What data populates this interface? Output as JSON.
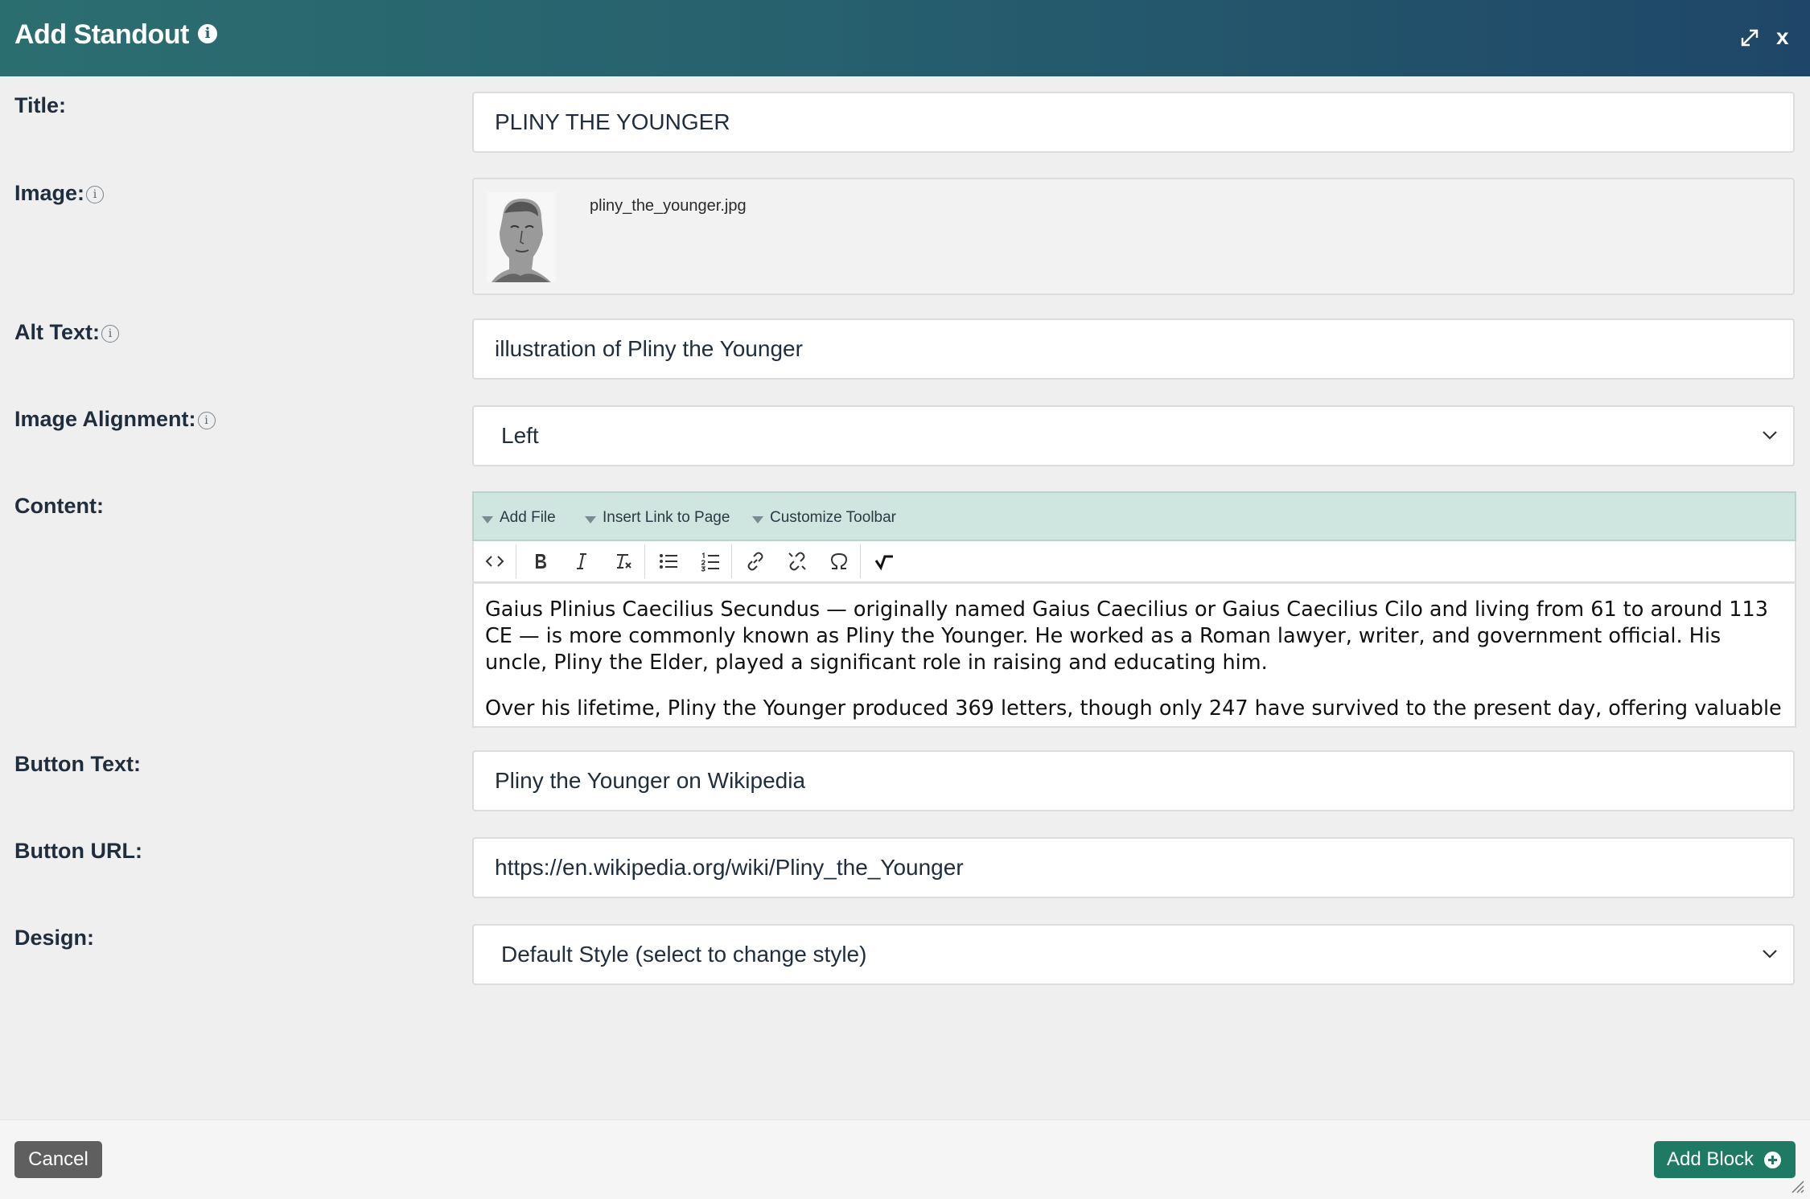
{
  "dialog": {
    "title": "Add Standout",
    "info_icon_glyph": "i",
    "close_label": "x"
  },
  "form": {
    "title": {
      "label": "Title:",
      "value": "PLINY THE YOUNGER"
    },
    "image": {
      "label": "Image:",
      "filename": "pliny_the_younger.jpg"
    },
    "alt_text": {
      "label": "Alt Text:",
      "value": "illustration of Pliny the Younger"
    },
    "image_alignment": {
      "label": "Image Alignment:",
      "value": "Left"
    },
    "content": {
      "label": "Content:",
      "menus": [
        "Add File",
        "Insert Link to Page",
        "Customize Toolbar"
      ],
      "toolbar_icons": [
        "source-code-icon",
        "bold-icon",
        "italic-icon",
        "remove-format-icon",
        "bulleted-list-icon",
        "numbered-list-icon",
        "link-icon",
        "unlink-icon",
        "special-character-icon",
        "check-icon"
      ],
      "paragraphs": [
        "Gaius Plinius Caecilius Secundus — originally named Gaius Caecilius or Gaius Caecilius Cilo and living from 61 to around 113 CE — is more commonly known as Pliny the Younger. He worked as a Roman lawyer, writer, and government official. His uncle, Pliny the Elder, played a significant role in raising and educating him.",
        "Over his lifetime, Pliny the Younger produced 369 letters, though only 247 have survived to the present day, offering valuable"
      ]
    },
    "button_text": {
      "label": "Button Text:",
      "value": "Pliny the Younger on Wikipedia"
    },
    "button_url": {
      "label": "Button URL:",
      "value": "https://en.wikipedia.org/wiki/Pliny_the_Younger"
    },
    "design": {
      "label": "Design:",
      "value": "Default Style (select to change style)"
    }
  },
  "info_small_glyph": "i",
  "footer": {
    "cancel_label": "Cancel",
    "add_label": "Add Block"
  },
  "colors": {
    "header_start": "#2b6e70",
    "header_end": "#1f4668",
    "editor_menu_bg": "#cfe5df",
    "primary_button": "#1f7a63",
    "cancel_button": "#5f5f5f"
  }
}
